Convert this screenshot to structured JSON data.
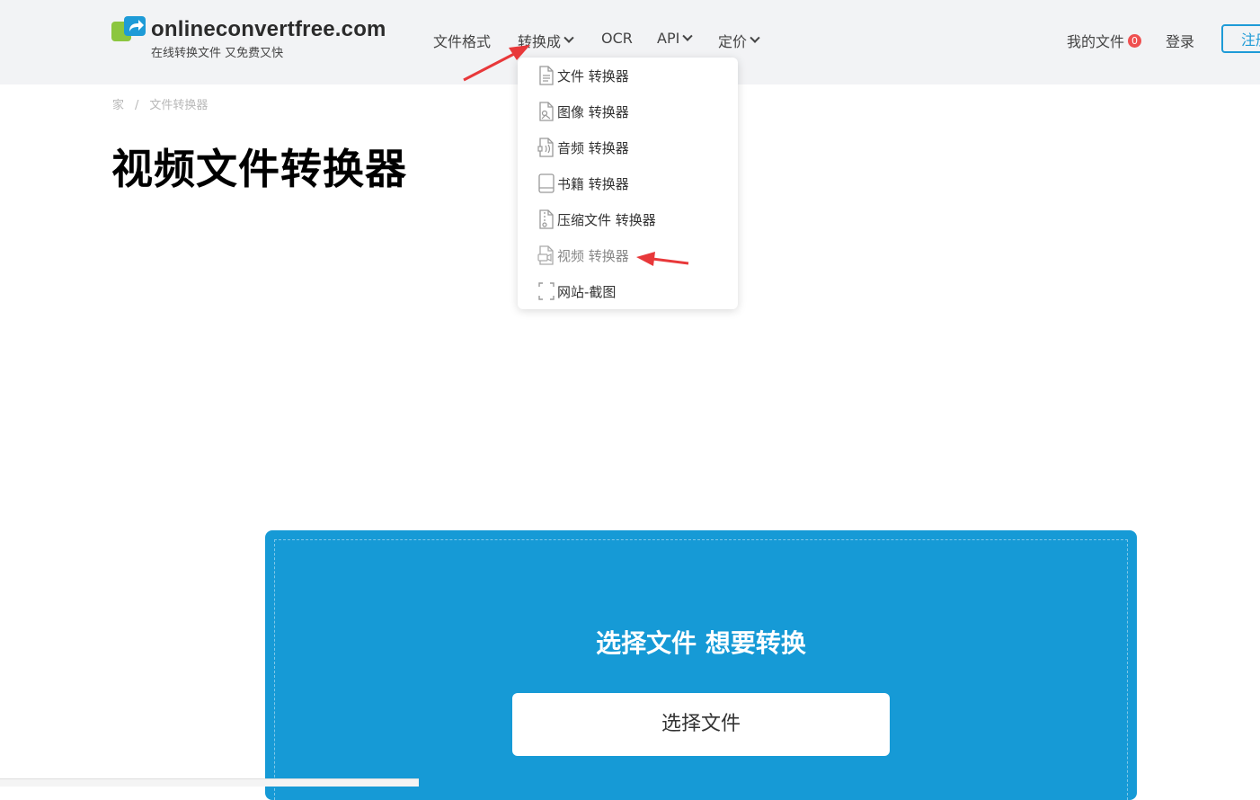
{
  "brand": {
    "name": "onlineconvertfree.com",
    "tagline": "在线转换文件 又免费又快"
  },
  "nav": {
    "items": [
      {
        "label": "文件格式"
      },
      {
        "label": "转换成"
      },
      {
        "label": "OCR"
      },
      {
        "label": "API"
      },
      {
        "label": "定价"
      }
    ],
    "my_files": "我的文件",
    "my_files_count": "0",
    "login": "登录",
    "register": "注册"
  },
  "breadcrumb": [
    "家",
    "/",
    "文件转换器"
  ],
  "page_title": "视频文件转换器",
  "dropdown": {
    "items": [
      {
        "label": "文件 转换器",
        "icon": "document-icon"
      },
      {
        "label": "图像 转换器",
        "icon": "image-file-icon"
      },
      {
        "label": "音频 转换器",
        "icon": "audio-file-icon"
      },
      {
        "label": "书籍 转换器",
        "icon": "book-icon"
      },
      {
        "label": "压缩文件 转换器",
        "icon": "archive-file-icon"
      },
      {
        "label": "视频 转换器",
        "icon": "video-file-icon"
      },
      {
        "label": "网站-截图",
        "icon": "screenshot-frame-icon"
      }
    ]
  },
  "upload": {
    "title": "选择文件 想要转换",
    "button": "选择文件"
  },
  "colors": {
    "accent": "#1e9bd7",
    "upload_bg": "#169ad6",
    "badge": "#ef5050",
    "annotation_arrow": "#e8383a"
  }
}
